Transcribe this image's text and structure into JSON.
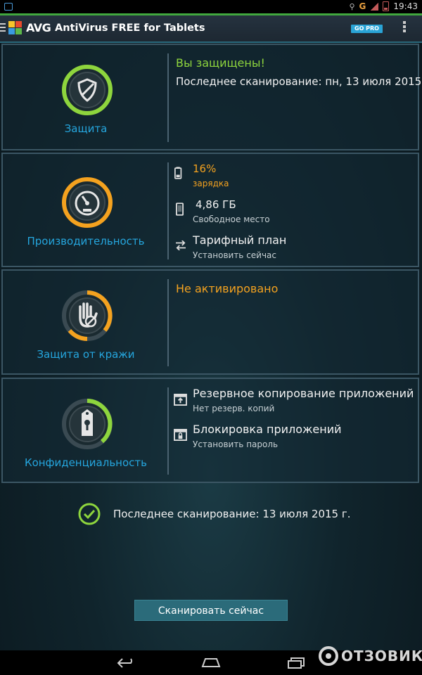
{
  "status_bar": {
    "time": "19:43",
    "network": "G"
  },
  "app": {
    "logo": "AVG",
    "title": "AntiVirus FREE for Tablets",
    "go_pro": "GO PRO"
  },
  "cards": {
    "protection": {
      "label": "Защита",
      "status": "Вы защищены!",
      "last_scan": "Последнее сканирование: пн, 13 июля 2015"
    },
    "performance": {
      "label": "Производительность",
      "battery_value": "16%",
      "battery_label": "зарядка",
      "storage_value": "4,86 ГБ",
      "storage_label": "Свободное место",
      "plan_title": "Тарифный план",
      "plan_action": "Установить сейчас"
    },
    "anti_theft": {
      "label": "Защита от кражи",
      "status": "Не активировано"
    },
    "privacy": {
      "label": "Конфиденциальность",
      "backup_title": "Резервное копирование приложений",
      "backup_status": "Нет резерв. копий",
      "lock_title": "Блокировка приложений",
      "lock_action": "Установить пароль"
    }
  },
  "footer": {
    "last_scan": "Последнее сканирование: 13 июля 2015 г.",
    "scan_button": "Сканировать сейчас"
  },
  "watermark": "ОТЗОВИК",
  "colors": {
    "accent_blue": "#25a6de",
    "ok_green": "#8ed53d",
    "warn_orange": "#f4a21f",
    "button": "#2b6b7a"
  }
}
